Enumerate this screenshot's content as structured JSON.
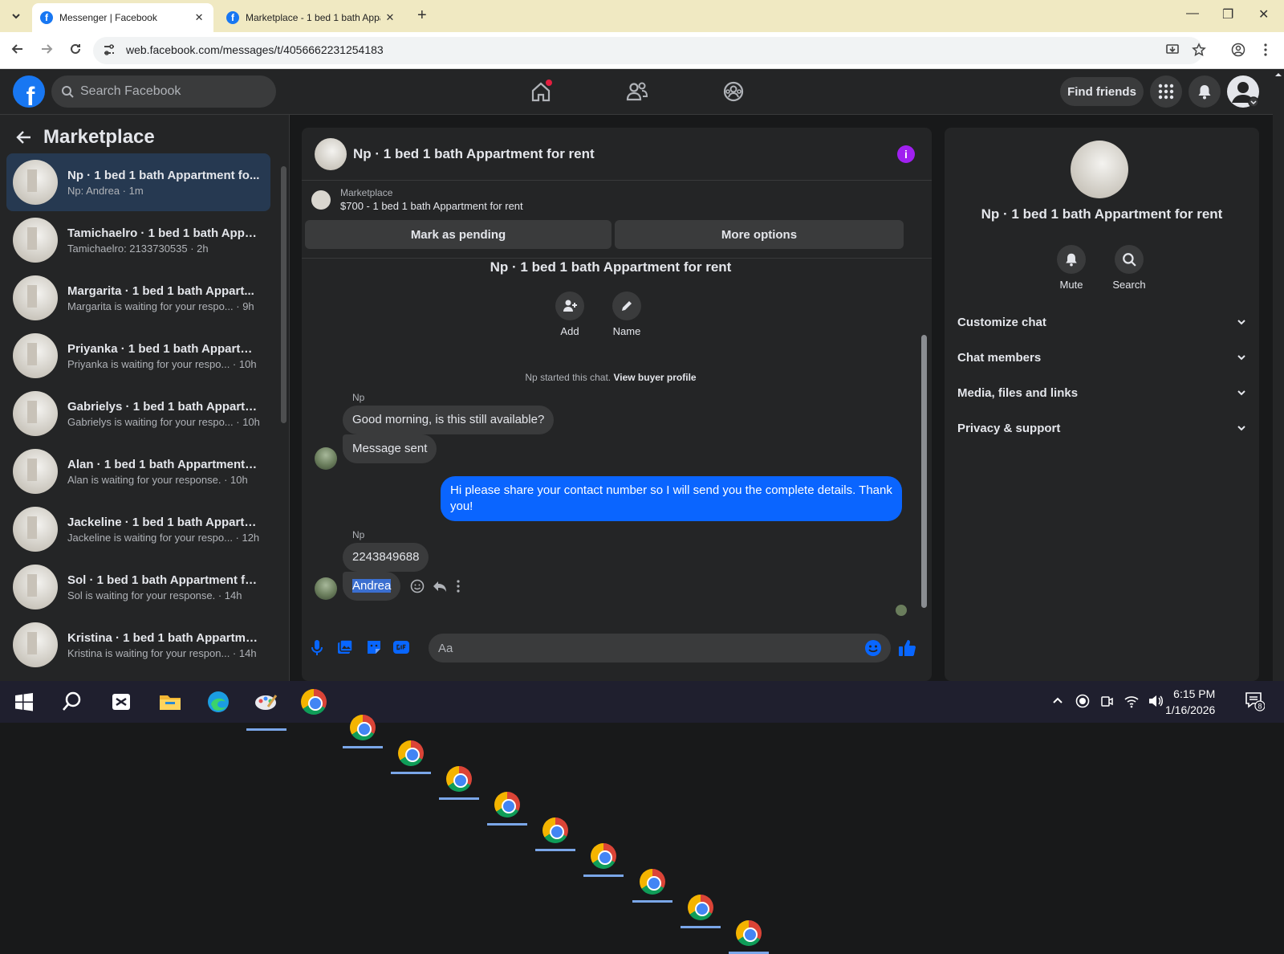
{
  "browser": {
    "tabs": [
      {
        "title": "Messenger | Facebook",
        "active": true
      },
      {
        "title": "Marketplace - 1 bed 1 bath Appartment for rent",
        "active": false
      }
    ],
    "url": "web.facebook.com/messages/t/4056662231254183"
  },
  "header": {
    "search_placeholder": "Search Facebook",
    "find_friends": "Find friends"
  },
  "sidebar": {
    "title": "Marketplace",
    "conversations": [
      {
        "name": "Np · 1 bed 1 bath Appartment fo...",
        "sub": "Np: Andrea · 1m",
        "selected": true
      },
      {
        "name": "Tamichaelro · 1 bed 1 bath Appa...",
        "sub": "Tamichaelro: 2133730535 · 2h"
      },
      {
        "name": "Margarita · 1 bed 1 bath Appart...",
        "sub": "Margarita is waiting for your respo... · 9h"
      },
      {
        "name": "Priyanka · 1 bed 1 bath Appartm...",
        "sub": "Priyanka is waiting for your respo... · 10h"
      },
      {
        "name": "Gabrielys · 1 bed 1 bath Appartm...",
        "sub": "Gabrielys is waiting for your respo... · 10h"
      },
      {
        "name": "Alan · 1 bed 1 bath Appartment f...",
        "sub": "Alan is waiting for your response. · 10h"
      },
      {
        "name": "Jackeline · 1 bed 1 bath Appartm...",
        "sub": "Jackeline is waiting for your respo... · 12h"
      },
      {
        "name": "Sol · 1 bed 1 bath Appartment fo...",
        "sub": "Sol is waiting for your response. · 14h"
      },
      {
        "name": "Kristina · 1 bed 1 bath Appartme...",
        "sub": "Kristina is waiting for your respon... · 14h"
      }
    ]
  },
  "chat": {
    "title": "Np · 1 bed 1 bath Appartment for rent",
    "marketplace_label": "Marketplace",
    "listing": "$700 - 1 bed 1 bath Appartment for rent",
    "mark_pending": "Mark as pending",
    "more_options": "More options",
    "add_label": "Add",
    "name_label": "Name",
    "started_text": "Np started this chat.",
    "view_profile": "View buyer profile",
    "messages": {
      "sender1": "Np",
      "m1": "Good morning, is this still available?",
      "m2": "Message sent",
      "m3": "Hi please share your contact number so I will send you the complete details. Thank you!",
      "sender2": "Np",
      "m4": "2243849688",
      "m5": "Andrea"
    },
    "composer_placeholder": "Aa"
  },
  "info": {
    "title": "Np · 1 bed 1 bath Appartment for rent",
    "mute": "Mute",
    "search": "Search",
    "sections": [
      "Customize chat",
      "Chat members",
      "Media, files and links",
      "Privacy & support"
    ]
  },
  "taskbar": {
    "time": "6:15 PM",
    "date": "1/16/2026",
    "notif_count": "8"
  },
  "colors": {
    "brand": "#1877f2",
    "outgoing_bubble": "#0a65ff",
    "info_accent": "#a020f0"
  }
}
